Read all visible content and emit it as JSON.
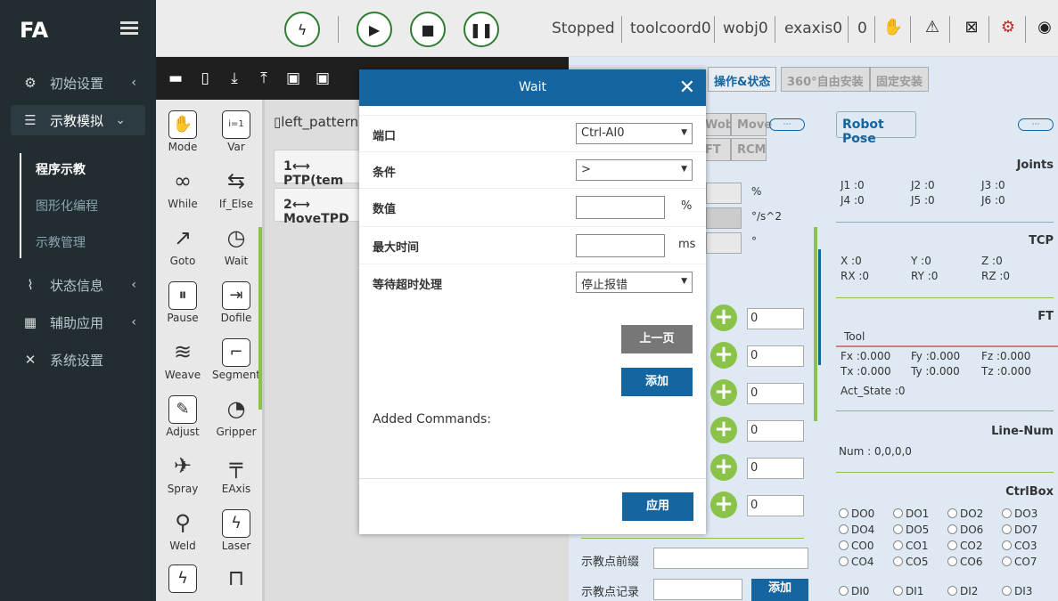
{
  "sidebar": {
    "logo": "FA",
    "items": [
      {
        "label": "初始设置",
        "icon": "gear-icon",
        "chev": "‹"
      },
      {
        "label": "示教模拟",
        "icon": "list-icon",
        "chev": "⌄"
      },
      {
        "label": "状态信息",
        "icon": "pulse-icon",
        "chev": "‹"
      },
      {
        "label": "辅助应用",
        "icon": "grid-icon",
        "chev": "‹"
      },
      {
        "label": "系统设置",
        "icon": "tools-icon",
        "chev": ""
      }
    ],
    "subitems": [
      "程序示教",
      "图形化编程",
      "示教管理"
    ]
  },
  "topbar": {
    "status": "Stopped",
    "tool": "toolcoord0",
    "wobj": "wobj0",
    "exaxis": "exaxis0",
    "num": "0"
  },
  "commands": [
    {
      "label": "Mode",
      "glyph": "✋"
    },
    {
      "label": "Var",
      "glyph": "i=1"
    },
    {
      "label": "While",
      "glyph": "∞"
    },
    {
      "label": "If_Else",
      "glyph": "⇆"
    },
    {
      "label": "Goto",
      "glyph": "↗"
    },
    {
      "label": "Wait",
      "glyph": "◷"
    },
    {
      "label": "Pause",
      "glyph": "⏸"
    },
    {
      "label": "Dofile",
      "glyph": "⇥"
    },
    {
      "label": "Weave",
      "glyph": "≋"
    },
    {
      "label": "Segment",
      "glyph": "⌐"
    },
    {
      "label": "Adjust",
      "glyph": "✎"
    },
    {
      "label": "Gripper",
      "glyph": "◔"
    },
    {
      "label": "Spray",
      "glyph": "✈"
    },
    {
      "label": "EAxis",
      "glyph": "╤"
    },
    {
      "label": "Weld",
      "glyph": "⚲"
    },
    {
      "label": "Laser",
      "glyph": "ϟ"
    },
    {
      "label": "",
      "glyph": "ϟ"
    },
    {
      "label": "",
      "glyph": "⊓"
    }
  ],
  "editor": {
    "file": "left_pattern",
    "rows": [
      "1⟷ PTP(tem",
      "2⟷ MoveTPD"
    ]
  },
  "rtabs": [
    "操作&状态",
    "360°自由安装",
    "固定安装"
  ],
  "midtabs": {
    "wobj": "Wobj",
    "move": "Move",
    "ft": "FT",
    "rcm": "RCM"
  },
  "units": [
    "%",
    "°/s^2",
    "°"
  ],
  "plusvals": [
    "0",
    "0",
    "0",
    "0",
    "0",
    "0"
  ],
  "right": {
    "pose": "Robot Pose",
    "joints": {
      "head": "Joints",
      "j1": "J1 :0",
      "j2": "J2 :0",
      "j3": "J3 :0",
      "j4": "J4 :0",
      "j5": "J5 :0",
      "j6": "J6 :0"
    },
    "tcp": {
      "head": "TCP",
      "x": "X :0",
      "y": "Y :0",
      "z": "Z :0",
      "rx": "RX :0",
      "ry": "RY :0",
      "rz": "RZ :0"
    },
    "ft": {
      "head": "FT",
      "tool": "Tool",
      "fx": "Fx :0.000",
      "fy": "Fy :0.000",
      "fz": "Fz :0.000",
      "tx": "Tx :0.000",
      "ty": "Ty :0.000",
      "tz": "Tz :0.000",
      "act": "Act_State :0"
    },
    "line": {
      "head": "Line-Num",
      "num": "Num : 0,0,0,0"
    },
    "ctrl": {
      "head": "CtrlBox",
      "items": [
        "DO0",
        "DO1",
        "DO2",
        "DO3",
        "DO4",
        "DO5",
        "DO6",
        "DO7",
        "CO0",
        "CO1",
        "CO2",
        "CO3",
        "CO4",
        "CO5",
        "CO6",
        "CO7",
        "DI0",
        "DI1",
        "DI2",
        "DI3"
      ]
    }
  },
  "bottom": {
    "prefix": "示教点前缀",
    "record": "示教点记录",
    "add": "添加"
  },
  "modal": {
    "title": "Wait",
    "close": "✕",
    "fields": [
      {
        "label": "端口",
        "value": "Ctrl-AI0"
      },
      {
        "label": "条件",
        "value": ">"
      },
      {
        "label": "数值",
        "unit": "%"
      },
      {
        "label": "最大时间",
        "unit": "ms"
      },
      {
        "label": "等待超时处理",
        "value": "停止报错"
      }
    ],
    "prev": "上一页",
    "add": "添加",
    "added": "Added Commands:",
    "apply": "应用"
  }
}
